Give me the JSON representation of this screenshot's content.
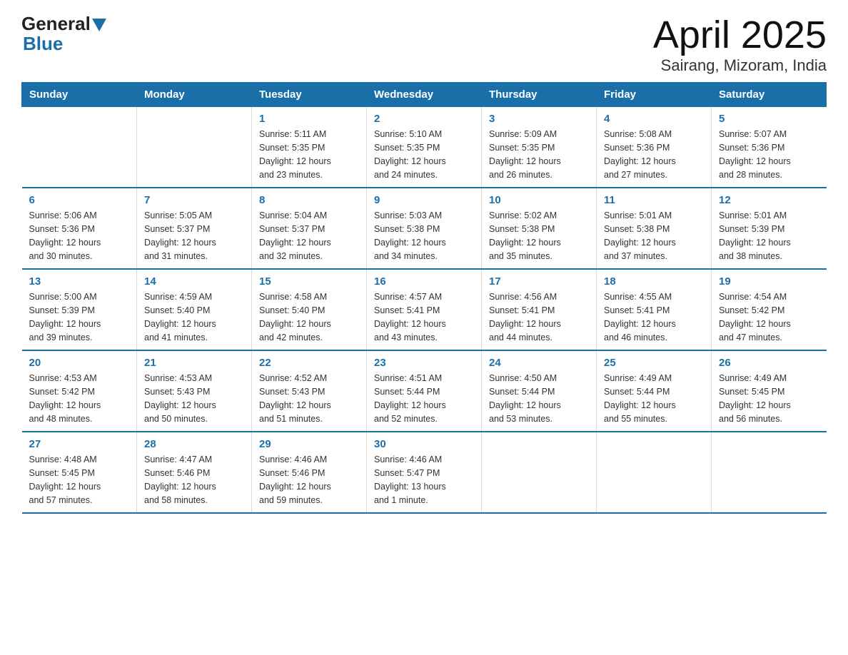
{
  "logo": {
    "general": "General",
    "blue": "Blue"
  },
  "title": "April 2025",
  "subtitle": "Sairang, Mizoram, India",
  "days_of_week": [
    "Sunday",
    "Monday",
    "Tuesday",
    "Wednesday",
    "Thursday",
    "Friday",
    "Saturday"
  ],
  "weeks": [
    [
      {
        "day": "",
        "info": ""
      },
      {
        "day": "",
        "info": ""
      },
      {
        "day": "1",
        "info": "Sunrise: 5:11 AM\nSunset: 5:35 PM\nDaylight: 12 hours\nand 23 minutes."
      },
      {
        "day": "2",
        "info": "Sunrise: 5:10 AM\nSunset: 5:35 PM\nDaylight: 12 hours\nand 24 minutes."
      },
      {
        "day": "3",
        "info": "Sunrise: 5:09 AM\nSunset: 5:35 PM\nDaylight: 12 hours\nand 26 minutes."
      },
      {
        "day": "4",
        "info": "Sunrise: 5:08 AM\nSunset: 5:36 PM\nDaylight: 12 hours\nand 27 minutes."
      },
      {
        "day": "5",
        "info": "Sunrise: 5:07 AM\nSunset: 5:36 PM\nDaylight: 12 hours\nand 28 minutes."
      }
    ],
    [
      {
        "day": "6",
        "info": "Sunrise: 5:06 AM\nSunset: 5:36 PM\nDaylight: 12 hours\nand 30 minutes."
      },
      {
        "day": "7",
        "info": "Sunrise: 5:05 AM\nSunset: 5:37 PM\nDaylight: 12 hours\nand 31 minutes."
      },
      {
        "day": "8",
        "info": "Sunrise: 5:04 AM\nSunset: 5:37 PM\nDaylight: 12 hours\nand 32 minutes."
      },
      {
        "day": "9",
        "info": "Sunrise: 5:03 AM\nSunset: 5:38 PM\nDaylight: 12 hours\nand 34 minutes."
      },
      {
        "day": "10",
        "info": "Sunrise: 5:02 AM\nSunset: 5:38 PM\nDaylight: 12 hours\nand 35 minutes."
      },
      {
        "day": "11",
        "info": "Sunrise: 5:01 AM\nSunset: 5:38 PM\nDaylight: 12 hours\nand 37 minutes."
      },
      {
        "day": "12",
        "info": "Sunrise: 5:01 AM\nSunset: 5:39 PM\nDaylight: 12 hours\nand 38 minutes."
      }
    ],
    [
      {
        "day": "13",
        "info": "Sunrise: 5:00 AM\nSunset: 5:39 PM\nDaylight: 12 hours\nand 39 minutes."
      },
      {
        "day": "14",
        "info": "Sunrise: 4:59 AM\nSunset: 5:40 PM\nDaylight: 12 hours\nand 41 minutes."
      },
      {
        "day": "15",
        "info": "Sunrise: 4:58 AM\nSunset: 5:40 PM\nDaylight: 12 hours\nand 42 minutes."
      },
      {
        "day": "16",
        "info": "Sunrise: 4:57 AM\nSunset: 5:41 PM\nDaylight: 12 hours\nand 43 minutes."
      },
      {
        "day": "17",
        "info": "Sunrise: 4:56 AM\nSunset: 5:41 PM\nDaylight: 12 hours\nand 44 minutes."
      },
      {
        "day": "18",
        "info": "Sunrise: 4:55 AM\nSunset: 5:41 PM\nDaylight: 12 hours\nand 46 minutes."
      },
      {
        "day": "19",
        "info": "Sunrise: 4:54 AM\nSunset: 5:42 PM\nDaylight: 12 hours\nand 47 minutes."
      }
    ],
    [
      {
        "day": "20",
        "info": "Sunrise: 4:53 AM\nSunset: 5:42 PM\nDaylight: 12 hours\nand 48 minutes."
      },
      {
        "day": "21",
        "info": "Sunrise: 4:53 AM\nSunset: 5:43 PM\nDaylight: 12 hours\nand 50 minutes."
      },
      {
        "day": "22",
        "info": "Sunrise: 4:52 AM\nSunset: 5:43 PM\nDaylight: 12 hours\nand 51 minutes."
      },
      {
        "day": "23",
        "info": "Sunrise: 4:51 AM\nSunset: 5:44 PM\nDaylight: 12 hours\nand 52 minutes."
      },
      {
        "day": "24",
        "info": "Sunrise: 4:50 AM\nSunset: 5:44 PM\nDaylight: 12 hours\nand 53 minutes."
      },
      {
        "day": "25",
        "info": "Sunrise: 4:49 AM\nSunset: 5:44 PM\nDaylight: 12 hours\nand 55 minutes."
      },
      {
        "day": "26",
        "info": "Sunrise: 4:49 AM\nSunset: 5:45 PM\nDaylight: 12 hours\nand 56 minutes."
      }
    ],
    [
      {
        "day": "27",
        "info": "Sunrise: 4:48 AM\nSunset: 5:45 PM\nDaylight: 12 hours\nand 57 minutes."
      },
      {
        "day": "28",
        "info": "Sunrise: 4:47 AM\nSunset: 5:46 PM\nDaylight: 12 hours\nand 58 minutes."
      },
      {
        "day": "29",
        "info": "Sunrise: 4:46 AM\nSunset: 5:46 PM\nDaylight: 12 hours\nand 59 minutes."
      },
      {
        "day": "30",
        "info": "Sunrise: 4:46 AM\nSunset: 5:47 PM\nDaylight: 13 hours\nand 1 minute."
      },
      {
        "day": "",
        "info": ""
      },
      {
        "day": "",
        "info": ""
      },
      {
        "day": "",
        "info": ""
      }
    ]
  ]
}
